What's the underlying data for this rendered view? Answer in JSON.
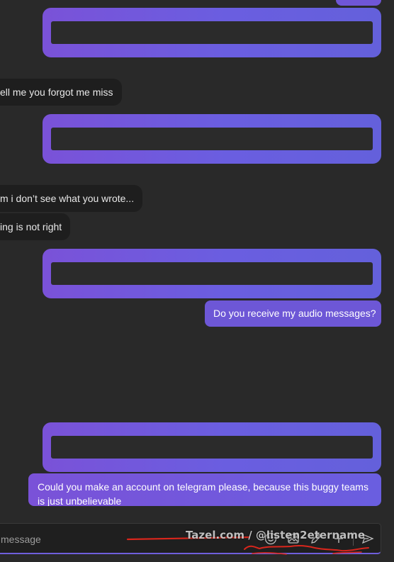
{
  "messages": {
    "received": [
      {
        "text": "ell me you forgot me miss"
      },
      {
        "text": "m i don’t see what you wrote..."
      },
      {
        "text": "ing is not right"
      }
    ],
    "sent": [
      {
        "text": "Do you receive my audio messages?"
      },
      {
        "text": "Could you make an account on telegram please, because this buggy teams is just unbelievable"
      }
    ]
  },
  "compose": {
    "placeholder": "message",
    "icons": [
      "emoji-icon",
      "image-icon",
      "pen-icon",
      "plus-icon",
      "send-icon"
    ]
  },
  "watermark": {
    "text": "Tazel.com / @listen2etername"
  },
  "colors": {
    "background": "#292929",
    "sent_bubble": "#6d57d6",
    "received_bubble": "#1e1e1e",
    "annotation": "#d9261c"
  }
}
